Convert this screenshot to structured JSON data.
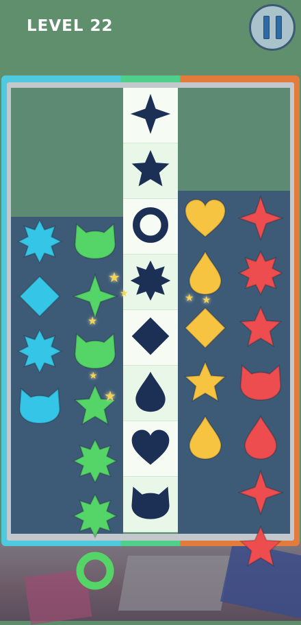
{
  "header": {
    "level_label": "LEVEL 22"
  },
  "colors": {
    "cyan": "#35c5e6",
    "green": "#55d467",
    "yellow": "#f7c441",
    "red": "#ee4d4f",
    "target": "#1c2f55"
  },
  "target_column": [
    "four-point-star",
    "star",
    "ring",
    "octagram",
    "diamond",
    "drop",
    "heart",
    "cat"
  ],
  "board": {
    "cyan_column": [
      "octagram",
      "diamond",
      "octagram",
      "cat"
    ],
    "green_column": [
      "cat",
      "four-point-star",
      "cat",
      "star",
      "octagram",
      "octagram",
      "ring"
    ],
    "yellow_column": [
      "heart",
      "drop",
      "diamond",
      "star",
      "drop"
    ],
    "red_column": [
      "four-point-star",
      "octagram",
      "star",
      "cat",
      "drop",
      "four-point-star",
      "star"
    ]
  }
}
